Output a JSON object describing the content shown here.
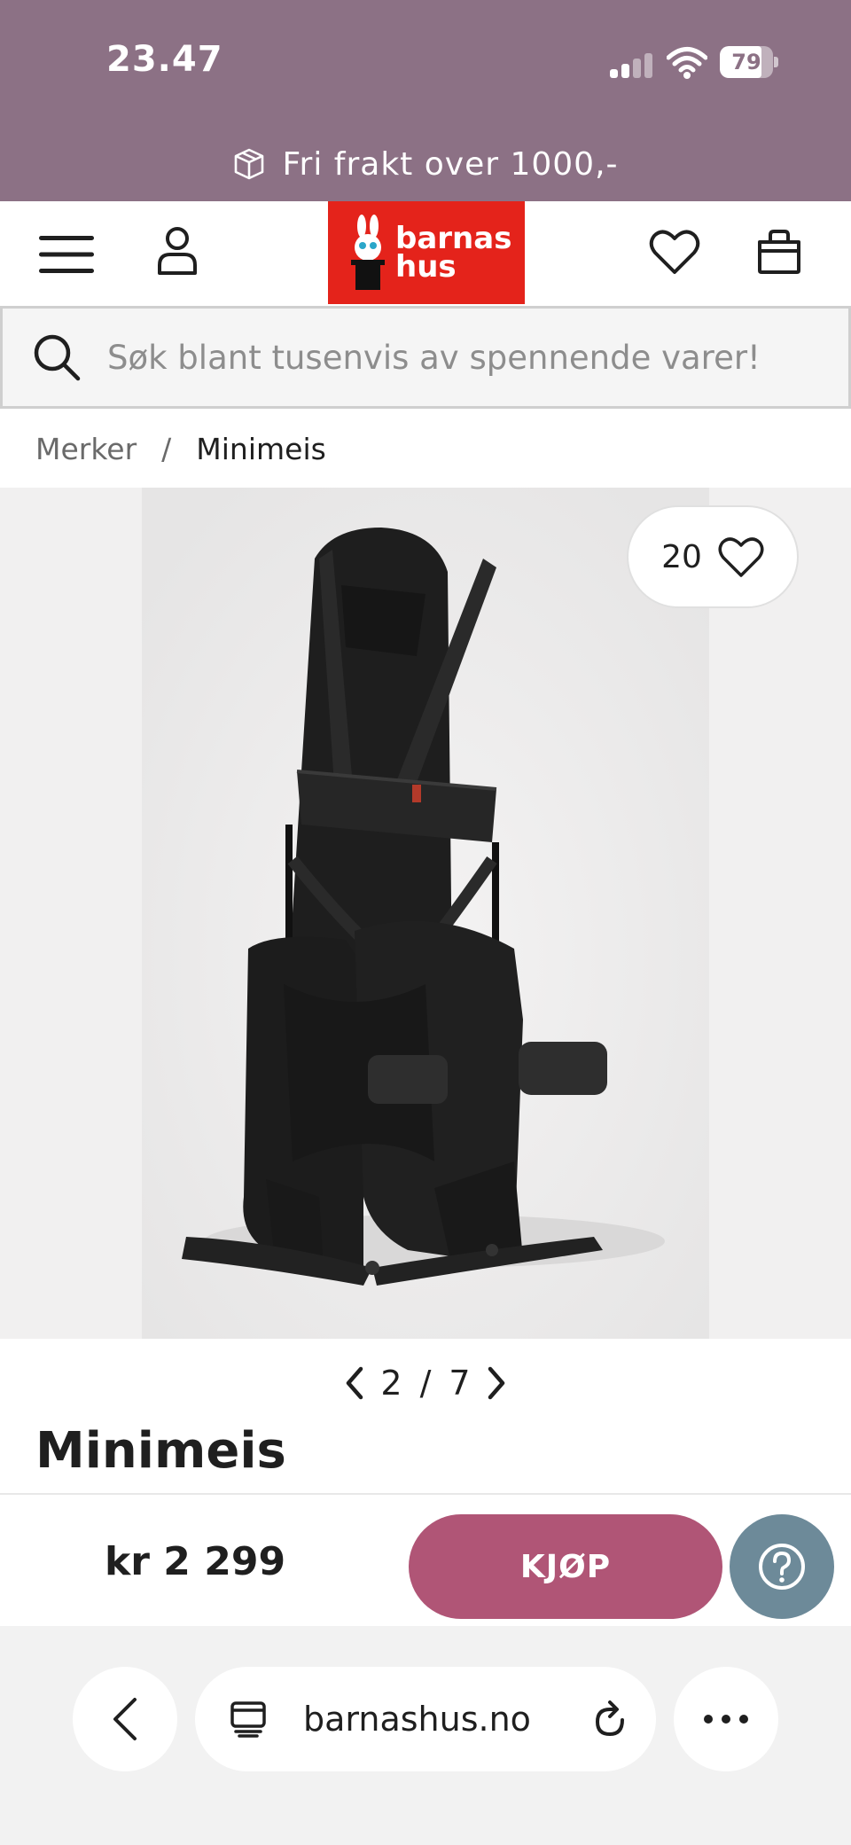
{
  "status_bar": {
    "time": "23.47",
    "battery": "79",
    "signal_bars_active": 2
  },
  "promo": {
    "text": "Fri frakt over 1000,-",
    "icon": "package-icon"
  },
  "header": {
    "logo_line1": "barnas",
    "logo_line2": "hus",
    "icons": [
      "menu-icon",
      "user-icon",
      "heart-icon",
      "shopping-bag-icon"
    ]
  },
  "search": {
    "placeholder": "Søk blant tusenvis av spennende varer!"
  },
  "breadcrumb": {
    "items": [
      "Merker",
      "Minimeis"
    ],
    "separator": "/"
  },
  "product": {
    "favorites_count": "20",
    "image_index": "2",
    "image_total": "7",
    "title": "Minimeis",
    "price": "kr 2 299",
    "buy_label": "KJØP"
  },
  "browser": {
    "url": "barnashus.no"
  },
  "colors": {
    "banner": "#8c7185",
    "logo_red": "#e4231b",
    "buy_button": "#b05576",
    "help_button": "#6d8a99"
  }
}
